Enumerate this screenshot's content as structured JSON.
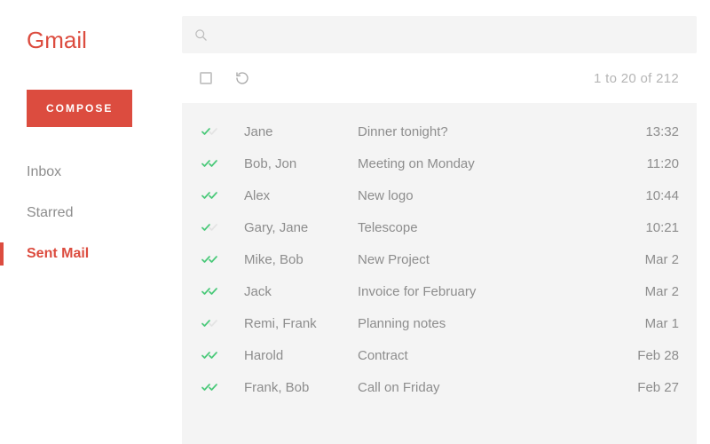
{
  "brand": "Gmail",
  "compose_label": "COMPOSE",
  "search": {
    "placeholder": ""
  },
  "nav": {
    "items": [
      {
        "label": "Inbox",
        "active": false
      },
      {
        "label": "Starred",
        "active": false
      },
      {
        "label": "Sent Mail",
        "active": true
      }
    ]
  },
  "page_count": "1 to 20 of 212",
  "messages": [
    {
      "sender": "Jane",
      "subject": "Dinner tonight?",
      "time": "13:32",
      "both_read": false
    },
    {
      "sender": "Bob, Jon",
      "subject": "Meeting on Monday",
      "time": "11:20",
      "both_read": true
    },
    {
      "sender": "Alex",
      "subject": "New logo",
      "time": "10:44",
      "both_read": true
    },
    {
      "sender": "Gary, Jane",
      "subject": "Telescope",
      "time": "10:21",
      "both_read": false
    },
    {
      "sender": "Mike, Bob",
      "subject": "New Project",
      "time": "Mar 2",
      "both_read": true
    },
    {
      "sender": "Jack",
      "subject": "Invoice for February",
      "time": "Mar 2",
      "both_read": true
    },
    {
      "sender": "Remi, Frank",
      "subject": "Planning notes",
      "time": "Mar 1",
      "both_read": false
    },
    {
      "sender": "Harold",
      "subject": "Contract",
      "time": "Feb 28",
      "both_read": true
    },
    {
      "sender": "Frank, Bob",
      "subject": "Call on Friday",
      "time": "Feb 27",
      "both_read": true
    }
  ]
}
